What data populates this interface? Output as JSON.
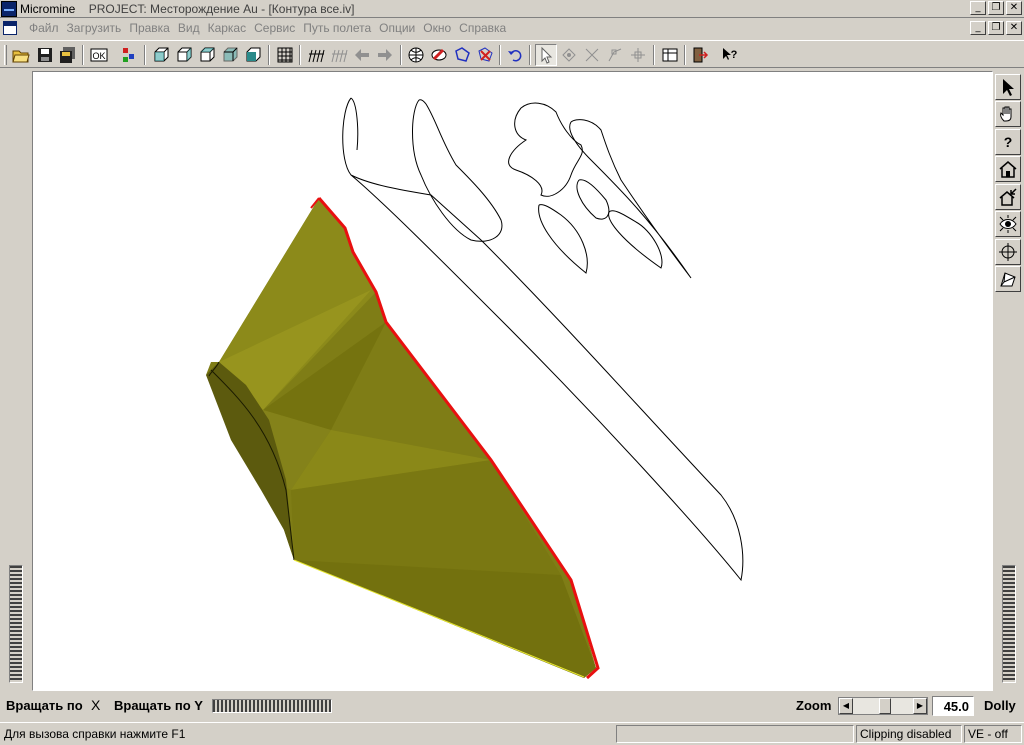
{
  "titlebar": {
    "app": "Micromine",
    "title": "PROJECT: Месторождение Au - [Контура все.iv]",
    "buttons": [
      "_",
      "❐",
      "✕"
    ]
  },
  "menubar": {
    "items": [
      "Файл",
      "Загрузить",
      "Правка",
      "Вид",
      "Каркас",
      "Сервис",
      "Путь полета",
      "Опции",
      "Окно",
      "Справка"
    ],
    "buttons": [
      "_",
      "❐",
      "✕"
    ]
  },
  "toolbar": {
    "ok_label": "OK",
    "icons": [
      "open-folder-icon",
      "save-icon",
      "save-all-icon",
      "ok-icon",
      "layers-icon",
      "cube-front-icon",
      "cube-back-icon",
      "cube-left-icon",
      "cube-right-icon",
      "cube-top-icon",
      "grid-icon",
      "flythrough-icon",
      "flythrough-disabled-icon",
      "arrow-left-icon",
      "arrow-right-icon",
      "sphere-icon",
      "eraser-icon",
      "polygon-icon",
      "polygon-delete-icon",
      "undo-icon",
      "select-arrow-icon",
      "vertex-tool-icon",
      "edge-tool-icon",
      "node-tool-icon",
      "move-node-icon",
      "table-icon",
      "exit-icon",
      "help-cursor-icon"
    ]
  },
  "right_tools": [
    "select-arrow-icon",
    "hand-pan-icon",
    "question-icon",
    "home-icon",
    "set-home-icon",
    "eye-icon",
    "seek-crosshair-icon",
    "projection-icon"
  ],
  "bottom": {
    "rotate_x": "Вращать по",
    "rotate_x_axis": "X",
    "rotate_y": "Вращать по Y",
    "zoom_label": "Zoom",
    "zoom_value": "45.0",
    "dolly_label": "Dolly"
  },
  "status": {
    "help": "Для вызова справки нажмите F1",
    "clipping": "Clipping disabled",
    "ve": "VE - off"
  },
  "colors": {
    "solid": "#7f7d16",
    "solid_light": "#a3a01c",
    "solid_dark": "#5c5a0e",
    "edge_red": "#e81010",
    "edge_yellow": "#e8e830"
  }
}
